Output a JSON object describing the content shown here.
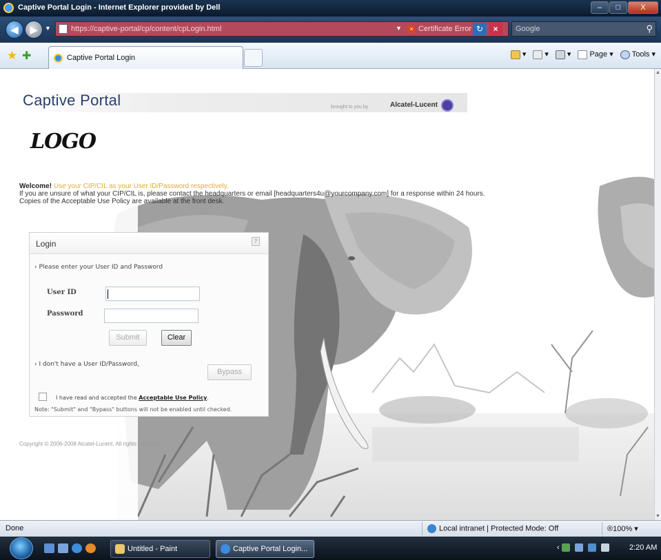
{
  "window": {
    "title": "Captive Portal Login - Internet Explorer provided by Dell",
    "min_label": "–",
    "max_label": "□",
    "close_label": "X"
  },
  "address": {
    "url": "https://captive-portal/cp/content/cpLogin.html",
    "cert_error": "Certificate Error",
    "search_placeholder": "Google"
  },
  "tabs": [
    {
      "label": "Captive Portal Login"
    }
  ],
  "toolbar": {
    "page_label": "Page ▾",
    "tools_label": "Tools ▾"
  },
  "portal": {
    "title": "Captive Portal",
    "brought_by": "brought to you by",
    "brand": "Alcatel-Lucent",
    "logo_text": "LOGO",
    "welcome_bold": "Welcome!",
    "welcome_orange": "Use your CIP/CIL as your User ID/Password respectively.",
    "welcome_line2": "If you are unsure of what your CIP/CIL is, please contact the headquarters or email [headquarters4u@yourcompany.com] for a response within 24 hours.",
    "welcome_line3": "Copies of the Acceptable Use Policy are available at the front desk.",
    "copyright": "Copyright © 2006-2008 Alcatel-Lucent. All rights reserved."
  },
  "login": {
    "heading": "Login",
    "help": "?",
    "prompt": "› Please enter your User ID and Password",
    "user_label": "User ID",
    "user_value": "",
    "pass_label": "Password",
    "pass_value": "",
    "submit": "Submit",
    "clear": "Clear",
    "no_id": "› I don't have a User ID/Password,",
    "bypass": "Bypass",
    "agree_prefix": "I have read and accepted the ",
    "agree_link": "Acceptable Use Policy",
    "agree_suffix": ".",
    "note": "Note: \"Submit\" and \"Bypass\" buttons will not be enabled until checked."
  },
  "status": {
    "left": "Done",
    "zone": "Local intranet | Protected Mode: Off",
    "zoom": "®100%  ▾"
  },
  "taskbar": {
    "paint": "Untitled - Paint",
    "ie": "Captive Portal Login...",
    "clock": "2:20 AM"
  },
  "colors": {
    "title_blue": "#2c3f6c",
    "welcome_orange": "#e8a83a"
  }
}
